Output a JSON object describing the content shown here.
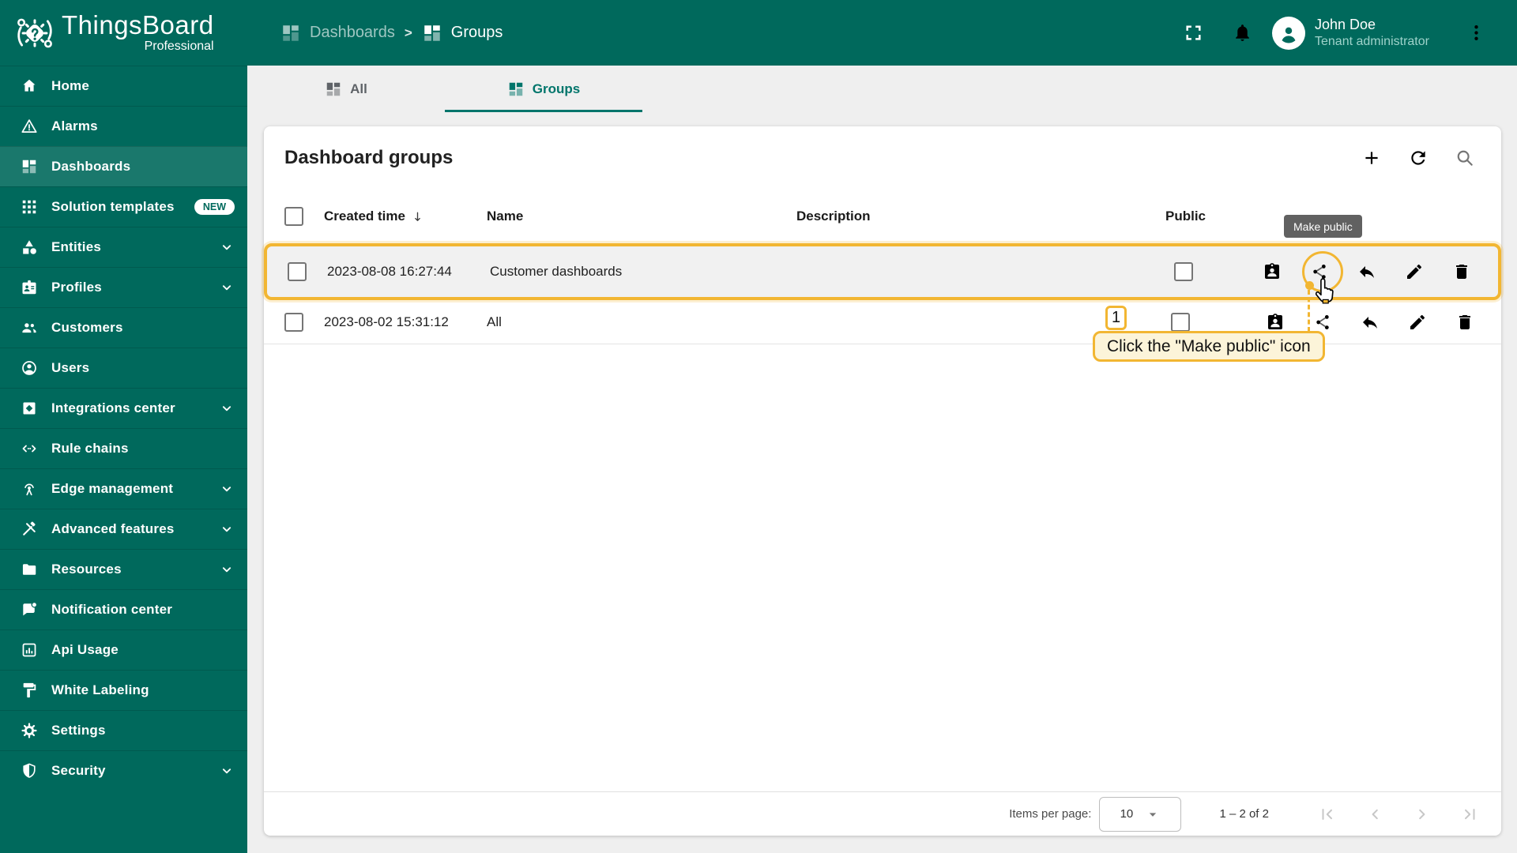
{
  "colors": {
    "primary": "#00695c",
    "accent_amber": "#F2B632",
    "tooltip_bg": "#616161",
    "callout_bg": "#FCF4D9"
  },
  "brand": {
    "name": "ThingsBoard",
    "edition": "Professional"
  },
  "breadcrumb": {
    "parent": "Dashboards",
    "separator": ">",
    "current": "Groups"
  },
  "topbar": {
    "user_name": "John Doe",
    "user_role": "Tenant administrator"
  },
  "sidebar": {
    "items": [
      {
        "label": "Home"
      },
      {
        "label": "Alarms"
      },
      {
        "label": "Dashboards",
        "active": true
      },
      {
        "label": "Solution templates",
        "badge": "NEW"
      },
      {
        "label": "Entities",
        "expandable": true
      },
      {
        "label": "Profiles",
        "expandable": true
      },
      {
        "label": "Customers"
      },
      {
        "label": "Users"
      },
      {
        "label": "Integrations center",
        "expandable": true
      },
      {
        "label": "Rule chains"
      },
      {
        "label": "Edge management",
        "expandable": true
      },
      {
        "label": "Advanced features",
        "expandable": true
      },
      {
        "label": "Resources",
        "expandable": true
      },
      {
        "label": "Notification center"
      },
      {
        "label": "Api Usage"
      },
      {
        "label": "White Labeling"
      },
      {
        "label": "Settings"
      },
      {
        "label": "Security",
        "expandable": true
      }
    ]
  },
  "tabs": {
    "all": "All",
    "groups": "Groups"
  },
  "panel": {
    "title": "Dashboard groups"
  },
  "table": {
    "columns": {
      "created": "Created time",
      "name": "Name",
      "description": "Description",
      "public": "Public"
    },
    "rows": [
      {
        "created": "2023-08-08 16:27:44",
        "name": "Customer dashboards",
        "description": "",
        "public": false
      },
      {
        "created": "2023-08-02 15:31:12",
        "name": "All",
        "description": "",
        "public": false
      }
    ]
  },
  "paginator": {
    "label": "Items per page:",
    "page_size": "10",
    "range": "1 – 2 of 2"
  },
  "tooltip": {
    "make_public": "Make public"
  },
  "annotation": {
    "step": "1",
    "instruction": "Click the \"Make public\" icon"
  }
}
